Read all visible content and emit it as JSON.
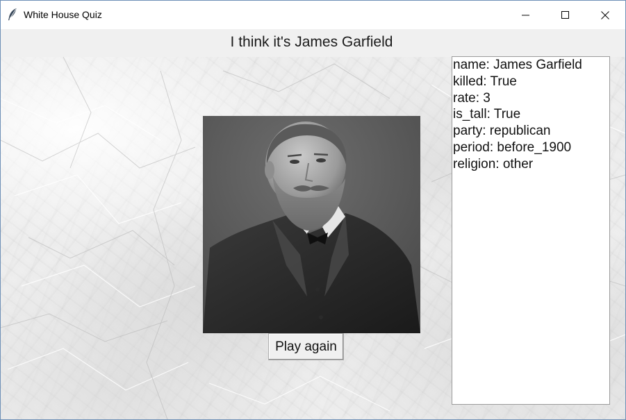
{
  "window": {
    "title": "White House Quiz",
    "icons": {
      "app": "feather-icon",
      "minimize": "minimize-icon",
      "maximize": "maximize-icon",
      "close": "close-icon"
    }
  },
  "header": {
    "text": "I think it's James Garfield"
  },
  "main": {
    "portrait": {
      "description": "portrait-photo",
      "tone": "black-and-white"
    },
    "play_again_label": "Play again"
  },
  "info": {
    "lines": [
      "name: James Garfield",
      "killed: True",
      "rate: 3",
      "is_tall: True",
      "party: republican",
      "period: before_1900",
      "religion: other"
    ]
  },
  "colors": {
    "titlebar_bg": "#ffffff",
    "header_bg": "#f0f0f0",
    "window_border": "#6d8fb6",
    "button_bg": "#f0f0f0"
  }
}
